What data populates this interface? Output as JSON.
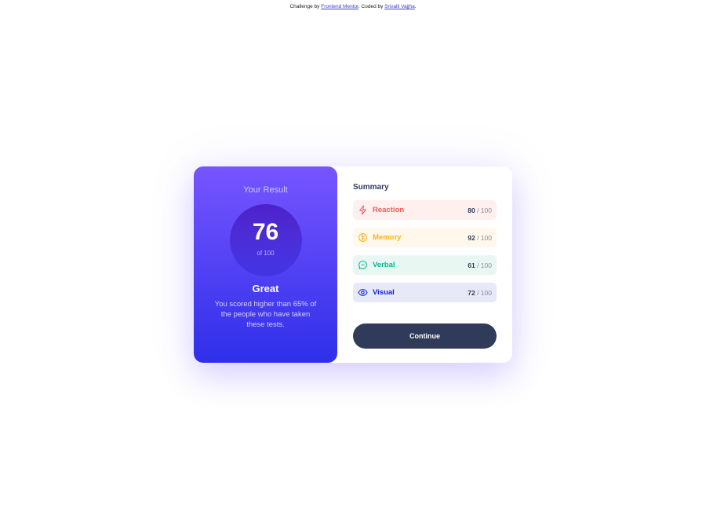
{
  "attribution": {
    "prefix": "Challenge by ",
    "link1": "Frontend Mentor",
    "middle": ". Coded by ",
    "link2": "Srivalli Vajjha",
    "suffix": "."
  },
  "result": {
    "title": "Your Result",
    "score": "76",
    "of": "of 100",
    "rating": "Great",
    "description": "You scored higher than 65% of the people who have taken these tests."
  },
  "summary": {
    "title": "Summary",
    "items": [
      {
        "label": "Reaction",
        "score": "80",
        "max": " / 100",
        "color": "#f55a5a",
        "bg": "#fdf0ef",
        "icon": "lightning-icon"
      },
      {
        "label": "Memory",
        "score": "92",
        "max": " / 100",
        "color": "#ffb21e",
        "bg": "#fff8eb",
        "icon": "brain-icon"
      },
      {
        "label": "Verbal",
        "score": "61",
        "max": " / 100",
        "color": "#00bb8f",
        "bg": "#e9f7f3",
        "icon": "chat-bubble-icon"
      },
      {
        "label": "Visual",
        "score": "72",
        "max": " / 100",
        "color": "#1125d4",
        "bg": "#e7e9f9",
        "icon": "eye-icon"
      }
    ],
    "button": "Continue"
  }
}
